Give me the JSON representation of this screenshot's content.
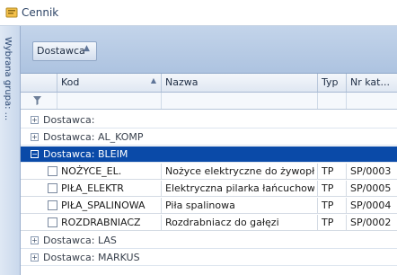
{
  "window": {
    "title": "Cennik"
  },
  "side_panel": {
    "label": "Wybrana grupa: ..."
  },
  "group_by": {
    "label": "Dostawca",
    "sort": "▲"
  },
  "columns": [
    {
      "label": "Kod",
      "sort": "▲"
    },
    {
      "label": "Nazwa"
    },
    {
      "label": "Typ"
    },
    {
      "label": "Nr kat..."
    }
  ],
  "groups": [
    {
      "label": "Dostawca:",
      "expander": "+"
    },
    {
      "label": "Dostawca: AL_KOMP",
      "expander": "+"
    },
    {
      "label": "Dostawca: BLEIM",
      "expander": "−"
    },
    {
      "label": "Dostawca: LAS",
      "expander": "+"
    },
    {
      "label": "Dostawca: MARKUS",
      "expander": "+"
    }
  ],
  "rows": [
    {
      "kod": "NOŻYCE_EL.",
      "nazwa": "Nożyce elektryczne do żywopłotu",
      "typ": "TP",
      "nr": "SP/0003"
    },
    {
      "kod": "PIŁA_ELEKTR",
      "nazwa": "Elektryczna pilarka łańcuchowa",
      "typ": "TP",
      "nr": "SP/0005"
    },
    {
      "kod": "PIŁA_SPALINOWA",
      "nazwa": "Piła spalinowa",
      "typ": "TP",
      "nr": "SP/0004"
    },
    {
      "kod": "ROZDRABNIACZ",
      "nazwa": "Rozdrabniacz do gałęzi",
      "typ": "TP",
      "nr": "SP/0002"
    }
  ],
  "colors": {
    "selected_group": "#0a4aa8",
    "group_panel": "#b7cbe5"
  }
}
